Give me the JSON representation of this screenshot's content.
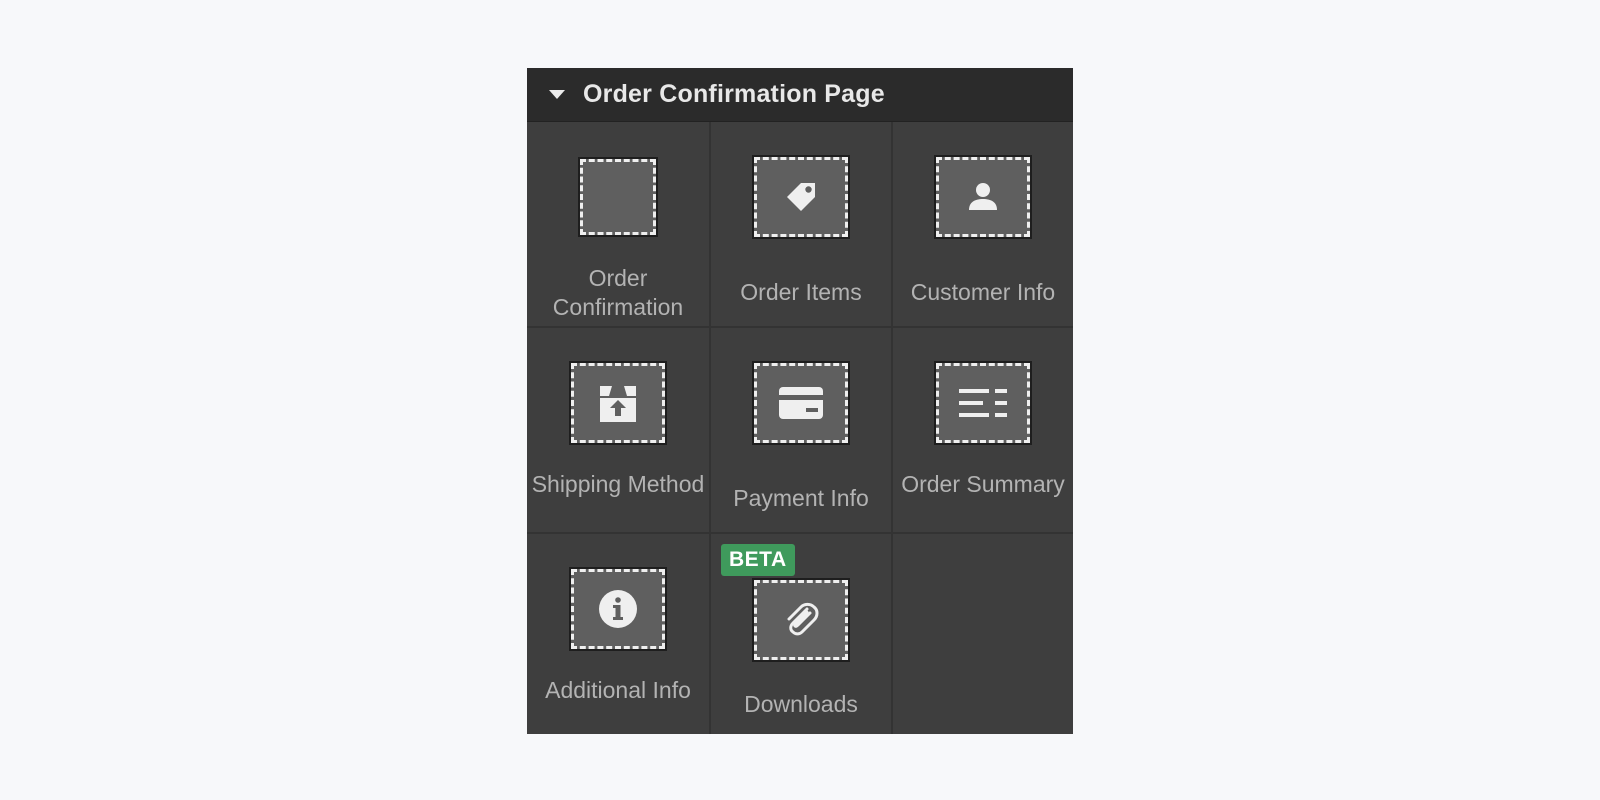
{
  "panel": {
    "title": "Order Confirmation Page"
  },
  "elements": [
    {
      "label": "Order Confirmation",
      "icon": "empty-block-icon"
    },
    {
      "label": "Order Items",
      "icon": "tag-icon"
    },
    {
      "label": "Customer Info",
      "icon": "person-icon"
    },
    {
      "label": "Shipping Method",
      "icon": "box-upload-icon"
    },
    {
      "label": "Payment Info",
      "icon": "credit-card-icon"
    },
    {
      "label": "Order Summary",
      "icon": "list-lines-icon"
    },
    {
      "label": "Additional Info",
      "icon": "info-icon"
    },
    {
      "label": "Downloads",
      "icon": "paperclip-icon",
      "badge": "BETA"
    }
  ],
  "colors": {
    "panel_bg": "#3e3e3e",
    "header_bg": "#2b2b2b",
    "badge_bg": "#3f9a5c",
    "label_text": "#b3b3b3"
  }
}
